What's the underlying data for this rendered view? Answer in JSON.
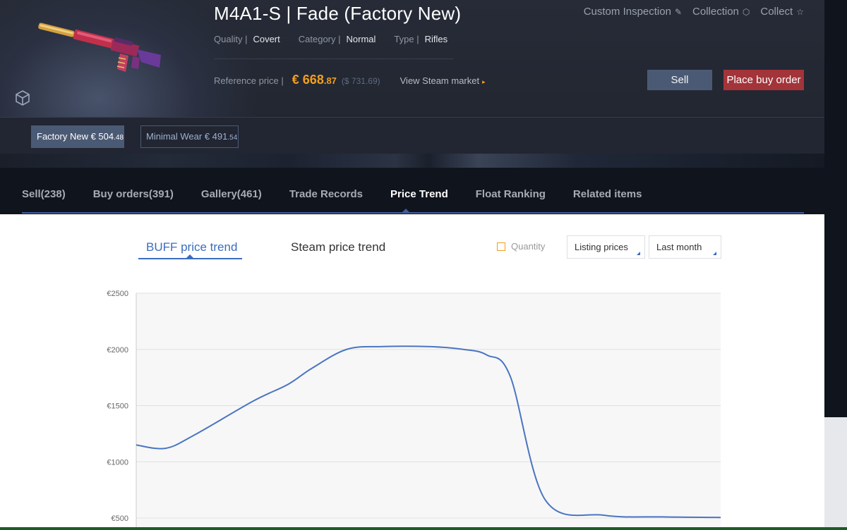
{
  "item": {
    "title": "M4A1-S | Fade (Factory New)",
    "quality_label": "Quality |",
    "quality_value": "Covert",
    "category_label": "Category |",
    "category_value": "Normal",
    "type_label": "Type |",
    "type_value": "Rifles",
    "reference_label": "Reference price |",
    "price_currency": "€",
    "price_int": "668",
    "price_dec": ".87",
    "price_usd": "($ 731.69)",
    "steam_link": "View Steam market",
    "accent_color": "#f0a020"
  },
  "top_links": {
    "custom_inspection": "Custom Inspection",
    "collection": "Collection",
    "collect": "Collect"
  },
  "actions": {
    "sell": "Sell",
    "buy_order": "Place buy order"
  },
  "wear": [
    {
      "label": "Factory New € 504",
      "dec": ".48",
      "active": true
    },
    {
      "label": "Minimal Wear € 491",
      "dec": ".54",
      "active": false
    }
  ],
  "tabs": [
    {
      "label": "Sell(238)"
    },
    {
      "label": "Buy orders(391)"
    },
    {
      "label": "Gallery(461)"
    },
    {
      "label": "Trade Records"
    },
    {
      "label": "Price Trend",
      "active": true
    },
    {
      "label": "Float Ranking"
    },
    {
      "label": "Related items"
    }
  ],
  "trend": {
    "buff_tab": "BUFF price trend",
    "steam_tab": "Steam price trend",
    "quantity_label": "Quantity",
    "listing_select": "Listing prices",
    "period_select": "Last month"
  },
  "chart_data": {
    "type": "line",
    "ylim": [
      500,
      2500
    ],
    "y_ticks": [
      "€2500",
      "€2000",
      "€1500",
      "€1000",
      "€500"
    ],
    "y_tick_values": [
      2500,
      2000,
      1500,
      1000,
      500
    ],
    "grid": true,
    "series": [
      {
        "color": "#4a75c2",
        "x": [
          0,
          0.05,
          0.1,
          0.2,
          0.26,
          0.3,
          0.36,
          0.42,
          0.5,
          0.56,
          0.6,
          0.64,
          0.7,
          0.8,
          0.9,
          1.0
        ],
        "values": [
          1150,
          1120,
          1240,
          1540,
          1690,
          1830,
          2000,
          2025,
          2025,
          2000,
          1950,
          1760,
          660,
          525,
          510,
          505
        ]
      }
    ]
  }
}
